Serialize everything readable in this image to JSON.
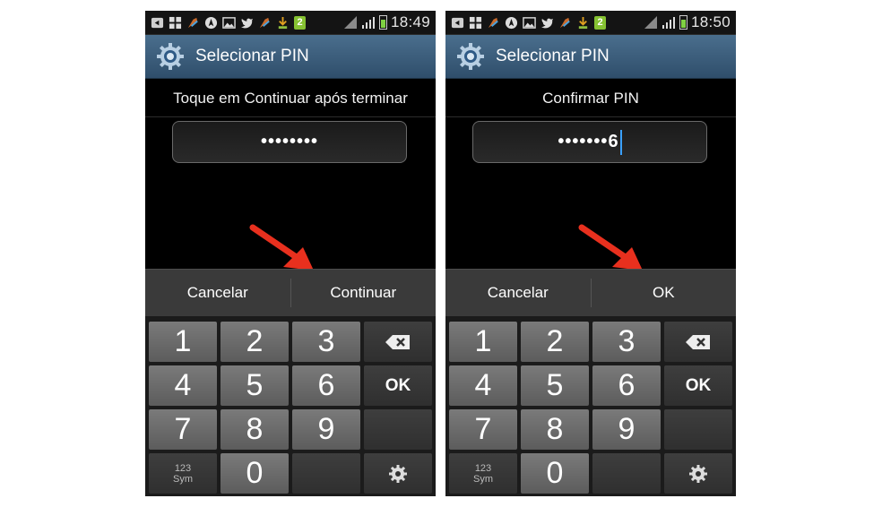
{
  "screens": [
    {
      "status_bar": {
        "time": "18:49",
        "notification_badge": "2",
        "icons": [
          "back-icon",
          "windows-icon",
          "paint-icon",
          "navigation-icon",
          "image-icon",
          "twitter-icon",
          "paint-icon",
          "download-icon"
        ]
      },
      "title": "Selecionar PIN",
      "instruction": "Toque em Continuar após terminar",
      "pin_value": "••••••••",
      "pin_last_char": "",
      "buttons": {
        "cancel": "Cancelar",
        "confirm": "Continuar"
      },
      "keypad": {
        "k1": "1",
        "k2": "2",
        "k3": "3",
        "k4": "4",
        "k5": "5",
        "k6": "6",
        "k7": "7",
        "k8": "8",
        "k9": "9",
        "k0": "0",
        "ok": "OK",
        "sym_top": "123",
        "sym_bottom": "Sym"
      }
    },
    {
      "status_bar": {
        "time": "18:50",
        "notification_badge": "2",
        "icons": [
          "back-icon",
          "windows-icon",
          "paint-icon",
          "navigation-icon",
          "image-icon",
          "twitter-icon",
          "paint-icon",
          "download-icon"
        ]
      },
      "title": "Selecionar PIN",
      "instruction": "Confirmar PIN",
      "pin_value": "•••••••",
      "pin_last_char": "6",
      "buttons": {
        "cancel": "Cancelar",
        "confirm": "OK"
      },
      "keypad": {
        "k1": "1",
        "k2": "2",
        "k3": "3",
        "k4": "4",
        "k5": "5",
        "k6": "6",
        "k7": "7",
        "k8": "8",
        "k9": "9",
        "k0": "0",
        "ok": "OK",
        "sym_top": "123",
        "sym_bottom": "Sym"
      }
    }
  ],
  "colors": {
    "arrow": "#e8301e",
    "title_bar": "#3d5f7e",
    "battery": "#7fd142",
    "cursor": "#3aa0ff"
  }
}
